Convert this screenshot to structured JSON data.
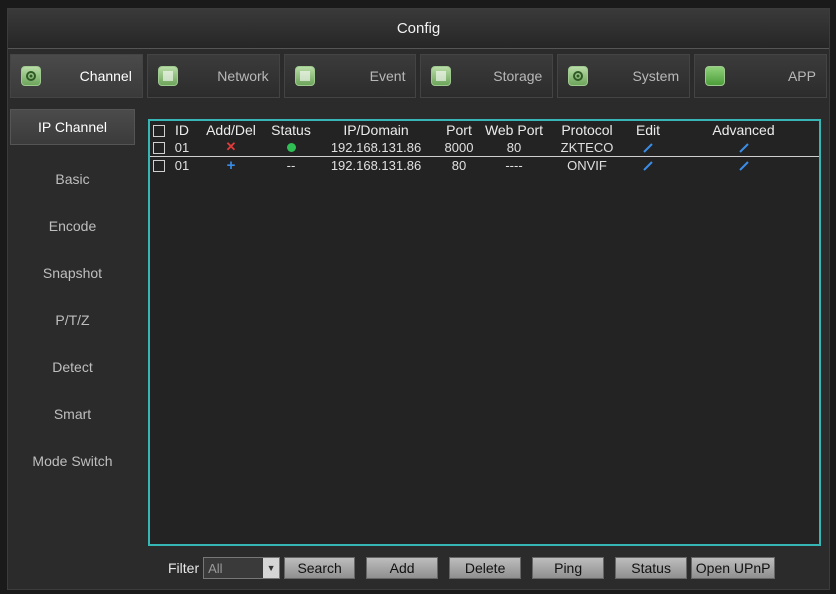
{
  "window": {
    "title": "Config"
  },
  "tabs": [
    {
      "label": "Channel",
      "icon": "gear-icon",
      "active": true
    },
    {
      "label": "Network",
      "icon": "network-icon",
      "active": false
    },
    {
      "label": "Event",
      "icon": "event-icon",
      "active": false
    },
    {
      "label": "Storage",
      "icon": "storage-icon",
      "active": false
    },
    {
      "label": "System",
      "icon": "gear-icon",
      "active": false
    },
    {
      "label": "APP",
      "icon": "app-icon",
      "active": false
    }
  ],
  "sidebar": {
    "items": [
      {
        "label": "IP Channel",
        "active": true
      },
      {
        "label": "Basic"
      },
      {
        "label": "Encode"
      },
      {
        "label": "Snapshot"
      },
      {
        "label": "P/T/Z"
      },
      {
        "label": "Detect"
      },
      {
        "label": "Smart"
      },
      {
        "label": "Mode Switch"
      }
    ]
  },
  "table": {
    "headers": [
      "ID",
      "Add/Del",
      "Status",
      "IP/Domain",
      "Port",
      "Web Port",
      "Protocol",
      "Edit",
      "Advanced"
    ],
    "rows": [
      {
        "id": "01",
        "action": "delete-icon",
        "status": "online-icon",
        "ip": "192.168.131.86",
        "port": "8000",
        "web_port": "80",
        "protocol": "ZKTECO"
      },
      {
        "id": "01",
        "action": "add-icon",
        "status": "--",
        "ip": "192.168.131.86",
        "port": "80",
        "web_port": "----",
        "protocol": "ONVIF"
      }
    ]
  },
  "bottombar": {
    "filter_label": "Filter",
    "filter_value": "All",
    "buttons": [
      "Search",
      "Add",
      "Delete",
      "Ping",
      "Status",
      "Open UPnP"
    ]
  },
  "colors": {
    "accent_border": "#37b6b6",
    "delete": "#e23b3b",
    "add": "#3a8ce6",
    "online": "#2fbf55",
    "edit": "#3a8ce6"
  }
}
